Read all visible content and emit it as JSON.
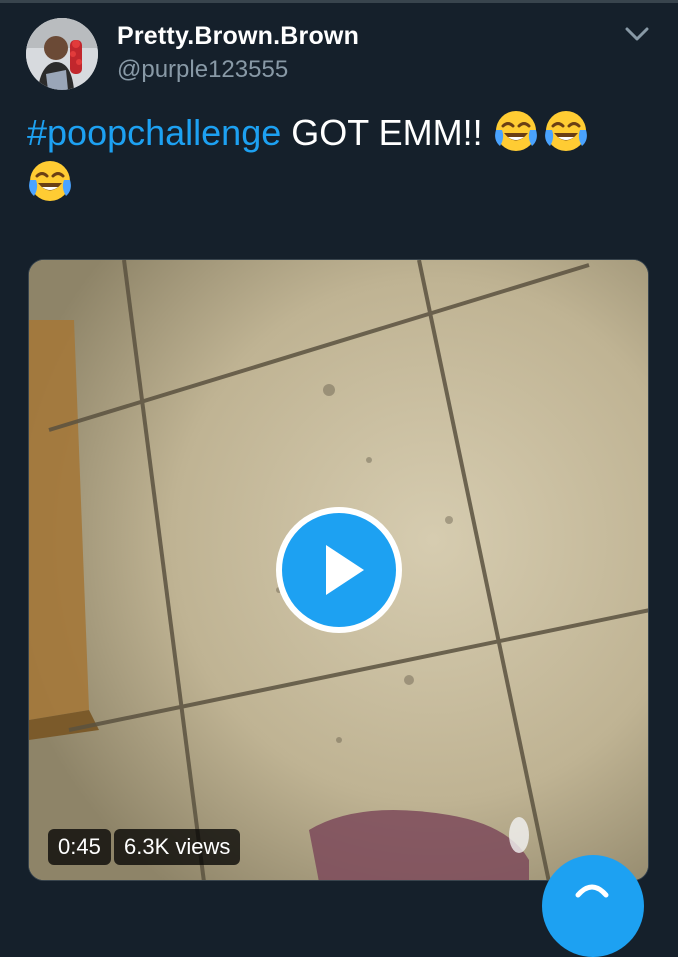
{
  "tweet": {
    "author_name": "Pretty.Brown.Brown",
    "author_handle": "@purple123555",
    "hashtag": "#poopchallenge",
    "text": "GOT EMM!!",
    "emojis": [
      "face-with-tears-of-joy-icon",
      "face-with-tears-of-joy-icon",
      "face-with-tears-of-joy-icon"
    ]
  },
  "media": {
    "type": "video",
    "duration": "0:45",
    "views": "6.3K views"
  },
  "colors": {
    "background": "#15202b",
    "accent": "#1da1f2",
    "secondary_text": "#8899a6"
  }
}
